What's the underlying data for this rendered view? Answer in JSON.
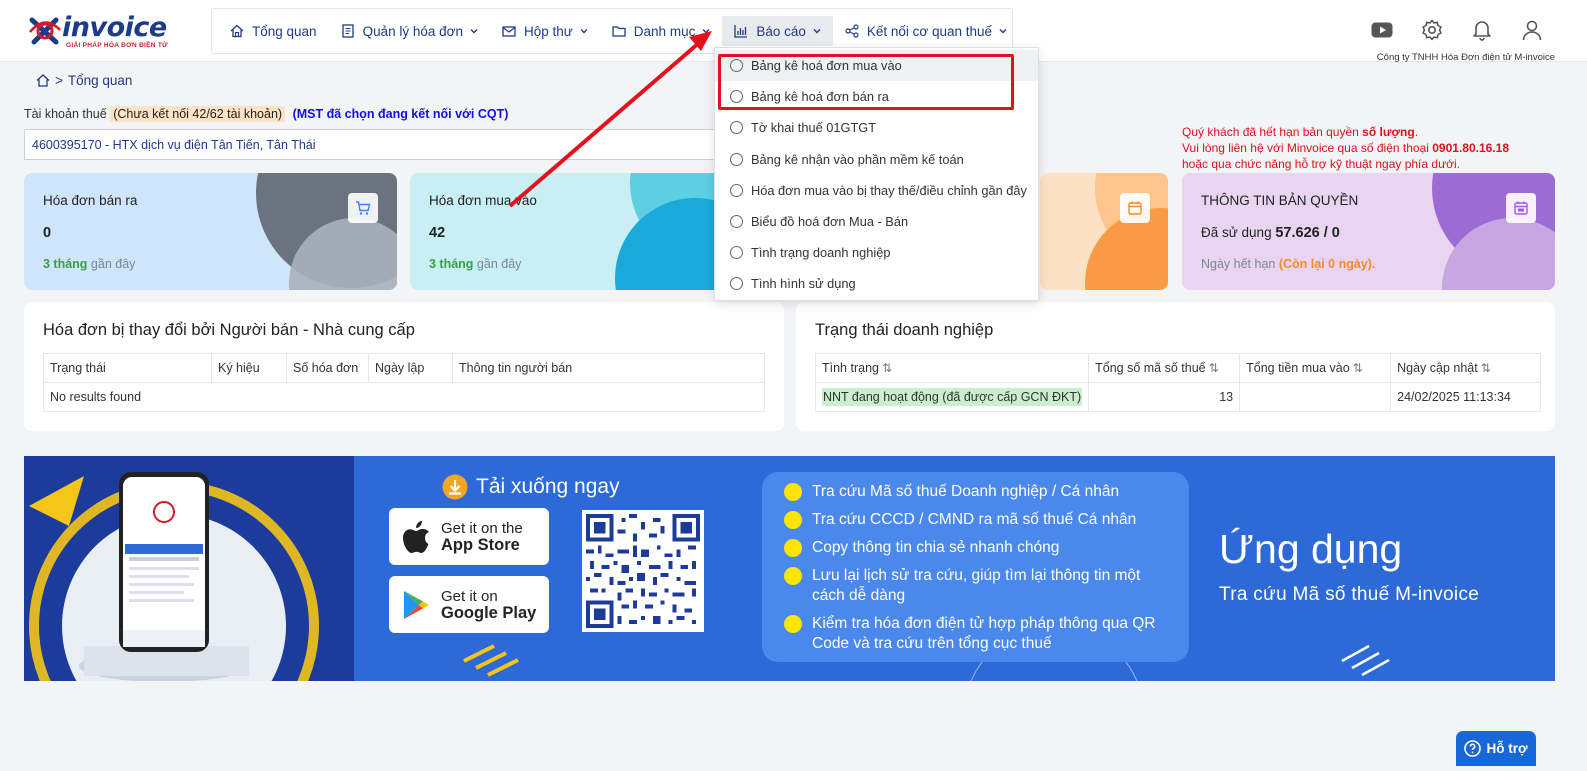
{
  "logo": {
    "brand": "invoice",
    "slogan": "GIẢI PHÁP HÓA ĐƠN ĐIỆN TỬ"
  },
  "nav": {
    "items": [
      {
        "label": "Tổng quan",
        "icon": "home-icon"
      },
      {
        "label": "Quản lý hóa đơn",
        "icon": "document-icon"
      },
      {
        "label": "Hộp thư",
        "icon": "mail-icon"
      },
      {
        "label": "Danh mục",
        "icon": "folder-icon"
      },
      {
        "label": "Báo cáo",
        "icon": "chart-icon"
      },
      {
        "label": "Kết nối cơ quan thuế",
        "icon": "share-icon"
      }
    ]
  },
  "header": {
    "company": "Công ty TNHH Hóa Đơn điện tử M-invoice"
  },
  "breadcrumb": {
    "label": "Tổng quan"
  },
  "tax": {
    "label": "Tài khoản thuế",
    "warning": "(Chưa kết nối 42/62 tài khoản)",
    "mst_note": "(MST đã chọn đang kết nối với CQT)",
    "selected": "4600395170 - HTX dịch vụ điện Tân Tiến, Tân Thái"
  },
  "notice": {
    "line1_pre": "Quý khách đã hết hạn bản quyền ",
    "line1_bold": "số lượng",
    "line1_post": ".",
    "line2_pre": "Vui lòng liên hệ với Minvoice qua số điện thoại ",
    "line2_phone": "0901.80.16.18",
    "line3": "hoặc qua chức năng hỗ trợ kỹ thuật ngay phía dưới."
  },
  "cards": {
    "sales": {
      "title": "Hóa đơn bán ra",
      "value": "0",
      "sub_bold": "3 tháng",
      "sub": " gần đây"
    },
    "purchase": {
      "title": "Hóa đơn mua vào",
      "value": "42",
      "sub_bold": "3 tháng",
      "sub": " gần đây"
    },
    "license": {
      "title": "THÔNG TIN BẢN QUYỀN",
      "used_label": "Đã sử dụng ",
      "used_value": "57.626 / 0",
      "expiry_label": "Ngày hết hạn ",
      "expiry_value": "(Còn lại 0 ngày)."
    }
  },
  "panel_changed": {
    "title": "Hóa đơn bị thay đổi bởi Người bán - Nhà cung cấp",
    "columns": [
      "Trạng thái",
      "Ký hiệu",
      "Số hóa đơn",
      "Ngày lập",
      "Thông tin người bán"
    ],
    "empty": "No results found"
  },
  "panel_status": {
    "title": "Trạng thái doanh nghiệp",
    "columns": [
      "Tình trạng",
      "Tổng số mã số thuế",
      "Tổng tiền mua vào",
      "Ngày cập nhật"
    ],
    "rows": [
      {
        "status": "NNT đang hoạt động (đã được cấp GCN ĐKT)",
        "count": "13",
        "amount": "",
        "updated": "24/02/2025 11:13:34"
      }
    ]
  },
  "dropdown": {
    "items": [
      "Bảng kê hoá đơn mua vào",
      "Bảng kê hoá đơn bán ra",
      "Tờ khai thuế 01GTGT",
      "Bảng kê nhận vào phần mềm kế toán",
      "Hóa đơn mua vào bị thay thế/điều chỉnh gần đây",
      "Biểu đồ hoá đơn Mua - Bán",
      "Tình trạng doanh nghiệp",
      "Tình hình sử dụng"
    ]
  },
  "banner": {
    "download": "Tải xuống ngay",
    "appstore_l1": "Get it on the",
    "appstore_l2": "App Store",
    "gplay_l1": "Get it on",
    "gplay_l2": "Google Play",
    "features": [
      "Tra cứu Mã số thuế Doanh nghiệp / Cá nhân",
      "Tra cứu CCCD / CMND ra mã số thuế Cá nhân",
      "Copy thông tin chia sẻ nhanh chóng",
      "Lưu lại lịch sử tra cứu, giúp tìm lại thông tin một cách dễ dàng",
      "Kiểm tra hóa đơn điện tử hợp pháp thông qua QR Code và tra cứu trên tổng cục thuế"
    ],
    "app_title": "Ứng dụng",
    "app_sub": "Tra cứu Mã số thuế M-invoice"
  },
  "help": {
    "label": "Hỗ trợ"
  },
  "colors": {
    "brand": "#1e3a8a",
    "alert": "#e0101b",
    "banner": "#2d6ad8",
    "success": "#3aa045"
  }
}
